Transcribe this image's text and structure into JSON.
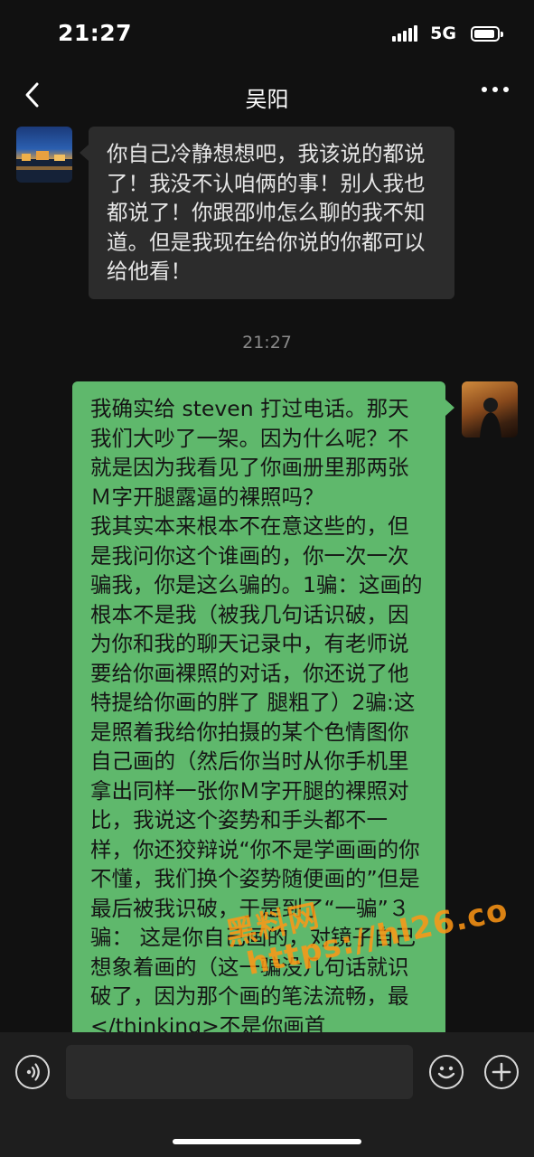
{
  "status": {
    "time": "21:27",
    "network": "5G"
  },
  "header": {
    "title": "吴阳"
  },
  "messages": {
    "incoming_text": "你自己冷静想想吧，我该说的都说了！我没不认咱俩的事！别人我也都说了！你跟邵帅怎么聊的我不知道。但是我现在给你说的你都可以给他看！",
    "timestamp": "21:27",
    "outgoing_text": "我确实给 steven 打过电话。那天我们大吵了一架。因为什么呢？不就是因为我看见了你画册里那两张Ｍ字开腿露逼的裸照吗？\n我其实本来根本不在意这些的，但是我问你这个谁画的，你一次一次骗我，你是这么骗的。1骗：这画的根本不是我（被我几句话识破，因为你和我的聊天记录中，有老师说要给你画裸照的对话，你还说了他特提给你画的胖了 腿粗了）2骗:这是照着我给你拍摄的某个色情图你自己画的（然后你当时从你手机里拿出同样一张你Ｍ字开腿的裸照对比，我说这个姿势和手头都不一样，你还狡辩说“你不是学画画的你不懂，我们换个姿势随便画的”但是最后被我识破，于是到了“一骗”３骗： 这是你自己画的，对镜子自己想象着画的（这一骗没几句话就识破了，因为那个画的笔法流畅，最</thinking>不是你画首"
  },
  "watermark": {
    "line1": "黑料网",
    "line2": "https://hl26.co"
  },
  "colors": {
    "background": "#111111",
    "incoming_bubble": "#2c2c2c",
    "outgoing_bubble": "#5fb86c",
    "input_bar": "#1e1e1e"
  },
  "icons": [
    "back-chevron-icon",
    "more-dots-icon",
    "voice-icon",
    "emoji-icon",
    "plus-icon",
    "signal-icon",
    "battery-icon"
  ]
}
